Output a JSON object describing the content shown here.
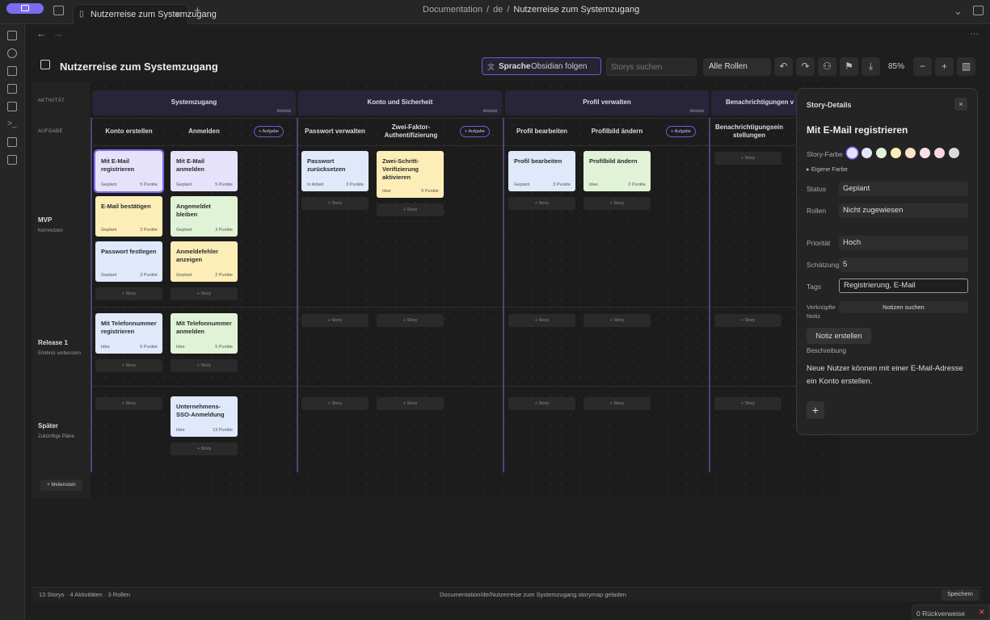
{
  "tab": {
    "title": "Nutzerreise zum Systemzugang",
    "close": "×",
    "new_tab": "+"
  },
  "nav": {
    "crumb1": "Documentation",
    "sep": "/",
    "crumb2": "de",
    "crumb3": "Nutzerreise zum Systemzugang",
    "more": "···",
    "back": "←",
    "forward": "→"
  },
  "header": {
    "title": "Nutzerreise zum Systemzugang",
    "language_label": "Sprache",
    "language_value": "Obsidian folgen",
    "search_placeholder": "Storys suchen",
    "roles": "Alle Rollen",
    "zoom": "85%"
  },
  "icons": {
    "undo": "↶",
    "redo": "↷",
    "users": "⚇",
    "flag": "⚑",
    "download": "⤓",
    "minus": "−",
    "plus": "+",
    "panel": "▥",
    "chev": "⌄"
  },
  "board": {
    "row_activity": "AKTIVITÄT",
    "row_task": "AUFGABE",
    "activity_suffix": "Aktivität",
    "add_task": "+ Aufgabe",
    "add_story": "+ Story",
    "add_milestone": "+ Meilenstein",
    "activities": [
      "Systemzugang",
      "Konto und Sicherheit",
      "Profil verwalten",
      "Benachrichtigungen v"
    ],
    "tasks": [
      "Konto erstellen",
      "Anmelden",
      "Passwort verwalten",
      "Zwei-Faktor-Authentifizierung",
      "Profil bearbeiten",
      "Profilbild ändern",
      "Benachrichtigungseinstellungen"
    ],
    "releases": [
      {
        "name": "MVP",
        "sub": "Kernnutzen"
      },
      {
        "name": "Release 1",
        "sub": "Erlebnis verbessern"
      },
      {
        "name": "Später",
        "sub": "Zukünftige Pläne"
      }
    ],
    "cards": [
      {
        "title": "Mit E-Mail registrieren",
        "status": "Geplant",
        "points": "5 Punkte",
        "color": "#e6e2fb"
      },
      {
        "title": "E-Mail bestätigen",
        "status": "Geplant",
        "points": "3 Punkte",
        "color": "#fdeeb8"
      },
      {
        "title": "Passwort festlegen",
        "status": "Geplant",
        "points": "3 Punkte",
        "color": "#dfe9fb"
      },
      {
        "title": "Mit E-Mail anmelden",
        "status": "Geplant",
        "points": "5 Punkte",
        "color": "#e6e2fb"
      },
      {
        "title": "Angemeldet bleiben",
        "status": "Geplant",
        "points": "3 Punkte",
        "color": "#e1f3d6"
      },
      {
        "title": "Anmeldefehler anzeigen",
        "status": "Geplant",
        "points": "2 Punkte",
        "color": "#fdeeb8"
      },
      {
        "title": "Passwort zurücksetzen",
        "status": "In Arbeit",
        "points": "3 Punkte",
        "color": "#dfe9fb"
      },
      {
        "title": "Zwei-Schritt-Verifizierung aktivieren",
        "status": "Idee",
        "points": "5 Punkte",
        "color": "#fdeeb8"
      },
      {
        "title": "Profil bearbeiten",
        "status": "Geplant",
        "points": "3 Punkte",
        "color": "#dfe9fb"
      },
      {
        "title": "Profilbild ändern",
        "status": "Idee",
        "points": "2 Punkte",
        "color": "#e1f3d6"
      },
      {
        "title": "Mit Telefonnummer registrieren",
        "status": "Idee",
        "points": "5 Punkte",
        "color": "#dfe9fb"
      },
      {
        "title": "Mit Telefonnummer anmelden",
        "status": "Idee",
        "points": "5 Punkte",
        "color": "#e1f3d6"
      },
      {
        "title": "Unternehmens-SSO-Anmeldung",
        "status": "Idee",
        "points": "13 Punkte",
        "color": "#dfe9fb"
      }
    ]
  },
  "panel": {
    "header": "Story-Details",
    "close": "×",
    "title": "Mit E-Mail registrieren",
    "color_label": "Story-Farbe",
    "custom_color": "▸ Eigene Farbe",
    "swatches": [
      "#e6e2fb",
      "#dfe9fb",
      "#e1f3d6",
      "#fdeeb8",
      "#fde3c8",
      "#fbe0e8",
      "#fbd5df",
      "#dadada"
    ],
    "status_label": "Status",
    "status_value": "Geplant",
    "roles_label": "Rollen",
    "roles_value": "Nicht zugewiesen",
    "priority_label": "Priorität",
    "priority_value": "Hoch",
    "estimate_label": "Schätzung",
    "estimate_value": "5",
    "tags_label": "Tags",
    "tags_value": "Registrierung, E-Mail",
    "linked_label1": "Verknüpfte",
    "linked_label2": "Notiz",
    "search_notes": "Notizen suchen",
    "create_note": "Notiz erstellen",
    "description_label": "Beschreibung",
    "description": "Neue Nutzer können mit einer E-Mail-Adresse ein Konto erstellen.",
    "add": "+"
  },
  "status": {
    "left": "13 Storys · 4 Aktivitäten · 3 Rollen",
    "middle": "Documentation/de/Nutzerreise zum Systemzugang.storymap geladen",
    "save": "Speichern",
    "backlinks": "0 Rückverweise"
  }
}
